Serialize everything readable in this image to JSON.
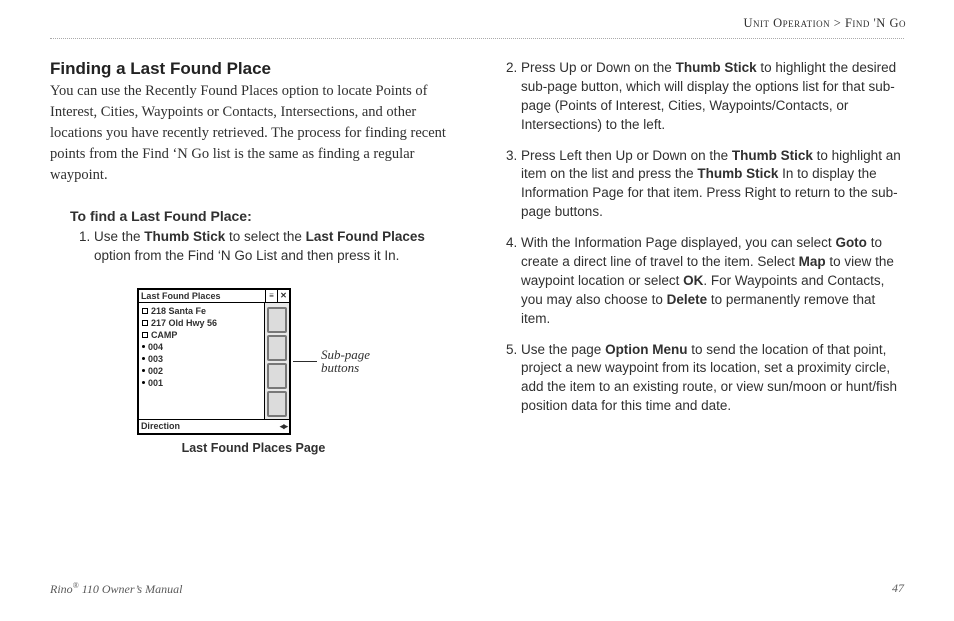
{
  "breadcrumb": {
    "section": "Unit Operation",
    "sep": " > ",
    "page": "Find 'N Go"
  },
  "heading": "Finding a Last Found Place",
  "intro": "You can use the Recently Found Places option to locate Points of Interest, Cities, Waypoints or Contacts, Intersections, and other locations you have recently retrieved. The process for finding recent points from the Find ‘N Go list is the same as finding a regular waypoint.",
  "sub_head": "To find a Last Found Place:",
  "step1": {
    "a": "Use the ",
    "b": "Thumb Stick",
    "c": " to select the ",
    "d": "Last Found Places",
    "e": " option from the Find ‘N Go List and then press it In."
  },
  "step2": {
    "a": "Press Up or Down on the ",
    "b": "Thumb Stick",
    "c": " to highlight the desired sub-page button, which will display the options list for that sub-page (Points of Interest, Cities, Waypoints/Contacts, or Intersections) to the left."
  },
  "step3": {
    "a": "Press Left then Up or Down on the ",
    "b": "Thumb Stick",
    "c": " to highlight an item on the list and press the ",
    "d": "Thumb Stick",
    "e": " In to display the Information Page for that item. Press Right to return to the sub-page buttons."
  },
  "step4": {
    "a": "With the Information Page displayed, you can select ",
    "b": "Goto",
    "c": " to create a direct line of travel to the item. Select ",
    "d": "Map",
    "e": " to view the waypoint location or select ",
    "f": "OK",
    "g": ". For Waypoints and Contacts, you may also choose to ",
    "h": "Delete",
    "i": " to permanently remove that item."
  },
  "step5": {
    "a": "Use the page ",
    "b": "Option Menu",
    "c": " to send the location of that point, project a new waypoint from its location, set a proximity circle, add the item to an existing route, or view sun/moon or hunt/fish position data for this time and date."
  },
  "figure": {
    "title": "Last Found Places",
    "items": [
      "218 Santa Fe",
      "217 Old Hwy 56",
      "CAMP",
      "004",
      "003",
      "002",
      "001"
    ],
    "bottom_label": "Direction",
    "callout1": "Sub-page",
    "callout2": "buttons",
    "caption": "Last Found Places Page"
  },
  "footer": {
    "product_a": "Rino",
    "product_reg": "®",
    "product_b": " 110 Owner’s Manual",
    "page_no": "47"
  }
}
